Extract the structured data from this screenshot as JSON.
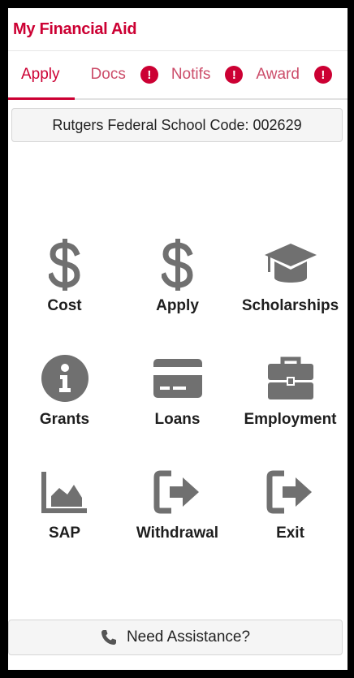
{
  "header": {
    "title": "My Financial Aid"
  },
  "tabs": [
    {
      "label": "Apply",
      "active": true,
      "alert": false
    },
    {
      "label": "Docs",
      "active": false,
      "alert": true
    },
    {
      "label": "Notifs",
      "active": false,
      "alert": true
    },
    {
      "label": "Award",
      "active": false,
      "alert": true
    }
  ],
  "alert_glyph": "!",
  "school_code": "Rutgers Federal School Code: 002629",
  "tiles": [
    {
      "label": "Cost",
      "icon": "dollar-icon"
    },
    {
      "label": "Apply",
      "icon": "dollar-icon"
    },
    {
      "label": "Scholarships",
      "icon": "graduation-cap-icon"
    },
    {
      "label": "Grants",
      "icon": "info-circle-icon"
    },
    {
      "label": "Loans",
      "icon": "credit-card-icon"
    },
    {
      "label": "Employment",
      "icon": "briefcase-icon"
    },
    {
      "label": "SAP",
      "icon": "area-chart-icon"
    },
    {
      "label": "Withdrawal",
      "icon": "sign-out-icon"
    },
    {
      "label": "Exit",
      "icon": "sign-out-icon"
    }
  ],
  "assistance": {
    "label": "Need Assistance?",
    "icon": "phone-icon"
  },
  "colors": {
    "accent": "#cc0033",
    "icon_gray": "#707070"
  }
}
